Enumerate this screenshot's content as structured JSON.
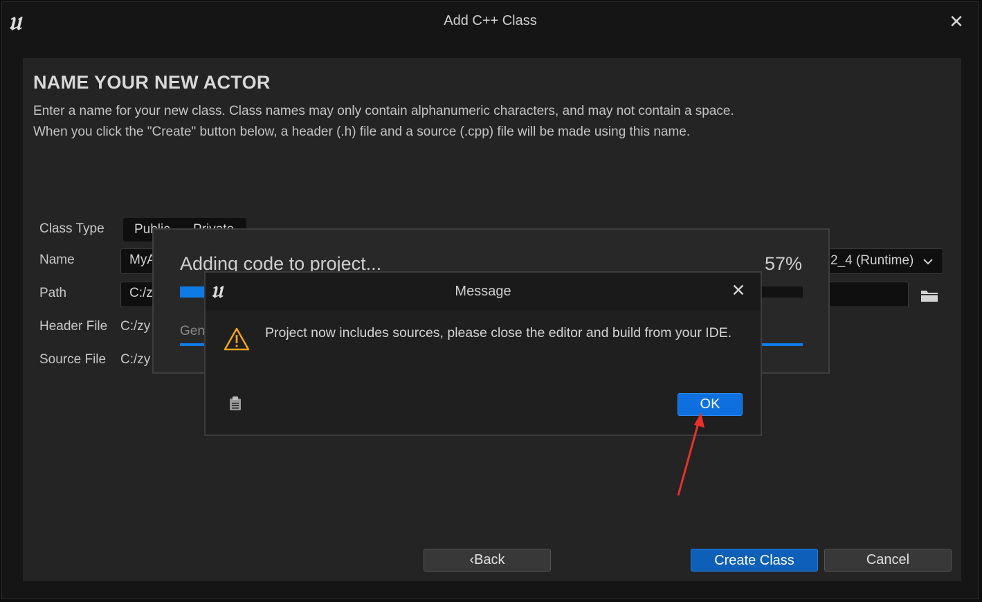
{
  "window": {
    "title": "Add C++ Class",
    "logo": "𝔲",
    "close_glyph": "✕"
  },
  "page": {
    "heading": "NAME YOUR NEW ACTOR",
    "desc_line1": "Enter a name for your new class. Class names may only contain alphanumeric characters, and may not contain a space.",
    "desc_line2": "When you click the \"Create\" button below, a header (.h) file and a source (.cpp) file will be made using this name."
  },
  "form": {
    "class_type_label": "Class Type",
    "public_label": "Public",
    "private_label": "Private",
    "name_label": "Name",
    "name_value": "MyA",
    "module_value": "2_4 (Runtime)",
    "path_label": "Path",
    "path_value": "C:/z",
    "header_label": "Header File",
    "header_value": "C:/zy",
    "source_label": "Source File",
    "source_value": "C:/zy"
  },
  "buttons": {
    "back": "‹Back",
    "create": "Create Class",
    "cancel": "Cancel"
  },
  "progress": {
    "title": "Adding code to project...",
    "percent_label": "57%",
    "percent": 57,
    "status": "Gen"
  },
  "message": {
    "title": "Message",
    "text": "Project now includes sources, please close the editor and build from your IDE.",
    "ok": "OK",
    "close_glyph": "✕"
  },
  "colors": {
    "accent": "#0e6fde",
    "annotation_arrow": "#e8312a"
  },
  "icons": [
    "unreal-logo-icon",
    "close-icon",
    "chevron-down-icon",
    "folder-icon",
    "warning-icon",
    "clipboard-icon"
  ]
}
